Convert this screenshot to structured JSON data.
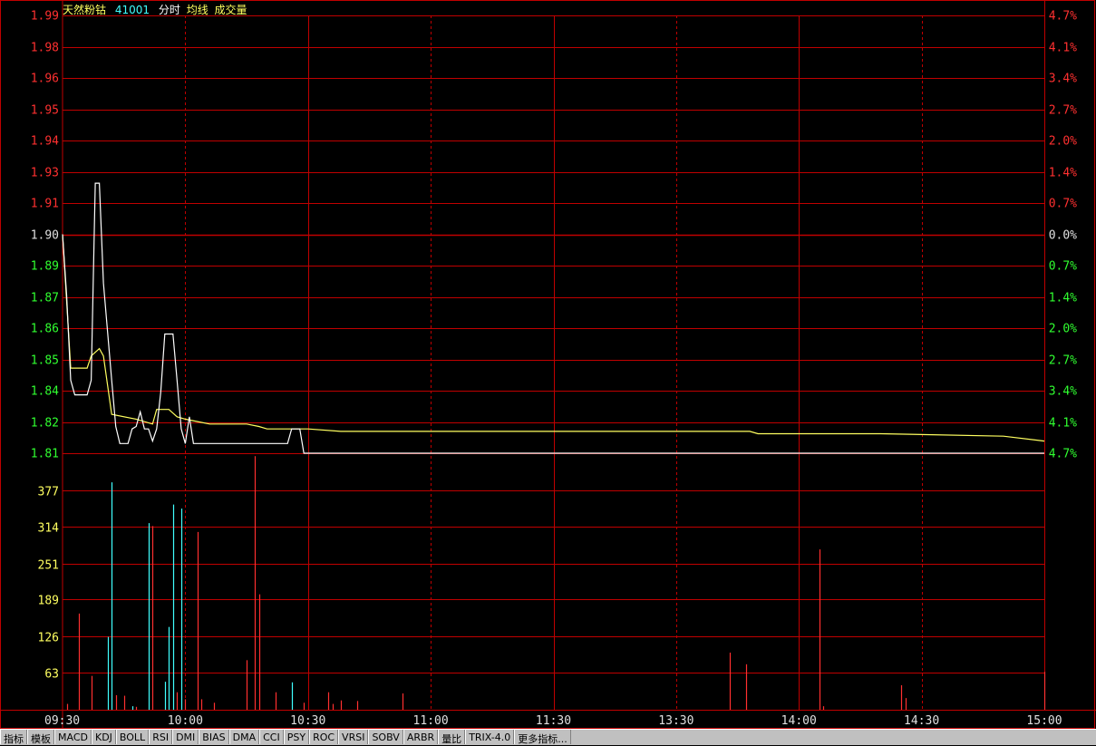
{
  "header": {
    "name": "天然粉钴",
    "code": "41001",
    "mode": "分时",
    "avg_label": "均线",
    "vol_label": "成交量"
  },
  "colors": {
    "grid": "#c00000",
    "price_up": "#ff3030",
    "price_down": "#30ff30",
    "price_flat": "#e0e0e0",
    "price_line": "#ffffff",
    "avg_line": "#ffff60",
    "vol_up": "#ff3030",
    "vol_down": "#40ffff",
    "time_label": "#e0e0e0",
    "vol_label": "#ffff60",
    "title": "#ffff60",
    "code": "#40ffff"
  },
  "chart_data": {
    "type": "line",
    "x_ticks": [
      "09:30",
      "10:00",
      "10:30",
      "11:00",
      "11:30",
      "13:30",
      "14:00",
      "14:30",
      "15:00"
    ],
    "price_axis": {
      "prev_close": 1.9,
      "left_labels": [
        "1.99",
        "1.98",
        "1.96",
        "1.95",
        "1.94",
        "1.93",
        "1.91",
        "1.90",
        "1.89",
        "1.87",
        "1.86",
        "1.85",
        "1.84",
        "1.82",
        "1.81"
      ],
      "right_labels": [
        "4.7%",
        "4.1%",
        "3.4%",
        "2.7%",
        "2.0%",
        "1.4%",
        "0.7%",
        "0.0%",
        "0.7%",
        "1.4%",
        "2.0%",
        "2.7%",
        "3.4%",
        "4.1%",
        "4.7%"
      ],
      "ylim": [
        1.81,
        1.99
      ]
    },
    "volume_axis": {
      "labels": [
        "377",
        "314",
        "251",
        "189",
        "126",
        "63"
      ],
      "ylim": [
        0,
        440
      ]
    },
    "price_series": {
      "name": "分时",
      "points": [
        [
          0,
          1.9
        ],
        [
          1,
          1.875
        ],
        [
          2,
          1.84
        ],
        [
          3,
          1.834
        ],
        [
          5,
          1.834
        ],
        [
          6,
          1.834
        ],
        [
          7,
          1.84
        ],
        [
          8,
          1.921
        ],
        [
          9,
          1.921
        ],
        [
          10,
          1.88
        ],
        [
          12,
          1.84
        ],
        [
          13,
          1.821
        ],
        [
          14,
          1.814
        ],
        [
          15,
          1.814
        ],
        [
          16,
          1.814
        ],
        [
          17,
          1.82
        ],
        [
          18,
          1.821
        ],
        [
          19,
          1.827
        ],
        [
          20,
          1.82
        ],
        [
          21,
          1.82
        ],
        [
          22,
          1.815
        ],
        [
          23,
          1.82
        ],
        [
          24,
          1.835
        ],
        [
          25,
          1.859
        ],
        [
          27,
          1.859
        ],
        [
          28,
          1.84
        ],
        [
          29,
          1.82
        ],
        [
          30,
          1.814
        ],
        [
          31,
          1.825
        ],
        [
          32,
          1.814
        ],
        [
          33,
          1.814
        ],
        [
          34,
          1.814
        ],
        [
          35,
          1.814
        ],
        [
          36,
          1.814
        ],
        [
          37,
          1.814
        ],
        [
          38,
          1.814
        ],
        [
          40,
          1.814
        ],
        [
          50,
          1.814
        ],
        [
          55,
          1.814
        ],
        [
          56,
          1.82
        ],
        [
          58,
          1.82
        ],
        [
          59,
          1.81
        ],
        [
          60,
          1.81
        ],
        [
          100,
          1.81
        ],
        [
          150,
          1.81
        ],
        [
          200,
          1.81
        ],
        [
          240,
          1.81
        ]
      ]
    },
    "avg_series": {
      "name": "均线",
      "points": [
        [
          0,
          1.9
        ],
        [
          2,
          1.845
        ],
        [
          6,
          1.845
        ],
        [
          7,
          1.85
        ],
        [
          9,
          1.853
        ],
        [
          10,
          1.85
        ],
        [
          12,
          1.826
        ],
        [
          18,
          1.824
        ],
        [
          22,
          1.822
        ],
        [
          23,
          1.828
        ],
        [
          26,
          1.828
        ],
        [
          28,
          1.825
        ],
        [
          30,
          1.824
        ],
        [
          33,
          1.823
        ],
        [
          36,
          1.822
        ],
        [
          40,
          1.822
        ],
        [
          45,
          1.822
        ],
        [
          48,
          1.821
        ],
        [
          50,
          1.82
        ],
        [
          60,
          1.82
        ],
        [
          68,
          1.819
        ],
        [
          100,
          1.819
        ],
        [
          140,
          1.819
        ],
        [
          168,
          1.819
        ],
        [
          170,
          1.818
        ],
        [
          200,
          1.818
        ],
        [
          230,
          1.817
        ],
        [
          240,
          1.815
        ]
      ]
    },
    "volume_bars": [
      {
        "m": 1,
        "v": 10,
        "dir": "up"
      },
      {
        "m": 4,
        "v": 165,
        "dir": "up"
      },
      {
        "m": 7,
        "v": 58,
        "dir": "up"
      },
      {
        "m": 11,
        "v": 125,
        "dir": "down"
      },
      {
        "m": 12,
        "v": 390,
        "dir": "down"
      },
      {
        "m": 13,
        "v": 25,
        "dir": "up"
      },
      {
        "m": 15,
        "v": 24,
        "dir": "up"
      },
      {
        "m": 17,
        "v": 6,
        "dir": "down"
      },
      {
        "m": 18,
        "v": 5,
        "dir": "up"
      },
      {
        "m": 21,
        "v": 320,
        "dir": "down"
      },
      {
        "m": 22,
        "v": 315,
        "dir": "up"
      },
      {
        "m": 25,
        "v": 48,
        "dir": "down"
      },
      {
        "m": 26,
        "v": 142,
        "dir": "down"
      },
      {
        "m": 27,
        "v": 352,
        "dir": "down"
      },
      {
        "m": 28,
        "v": 30,
        "dir": "up"
      },
      {
        "m": 29,
        "v": 345,
        "dir": "down"
      },
      {
        "m": 30,
        "v": 18,
        "dir": "up"
      },
      {
        "m": 33,
        "v": 305,
        "dir": "up"
      },
      {
        "m": 34,
        "v": 18,
        "dir": "up"
      },
      {
        "m": 37,
        "v": 12,
        "dir": "up"
      },
      {
        "m": 45,
        "v": 85,
        "dir": "up"
      },
      {
        "m": 47,
        "v": 435,
        "dir": "up"
      },
      {
        "m": 48,
        "v": 198,
        "dir": "up"
      },
      {
        "m": 52,
        "v": 30,
        "dir": "up"
      },
      {
        "m": 56,
        "v": 47,
        "dir": "down"
      },
      {
        "m": 59,
        "v": 12,
        "dir": "up"
      },
      {
        "m": 65,
        "v": 30,
        "dir": "up"
      },
      {
        "m": 66,
        "v": 10,
        "dir": "up"
      },
      {
        "m": 68,
        "v": 16,
        "dir": "up"
      },
      {
        "m": 72,
        "v": 15,
        "dir": "up"
      },
      {
        "m": 83,
        "v": 28,
        "dir": "up"
      },
      {
        "m": 163,
        "v": 98,
        "dir": "up"
      },
      {
        "m": 167,
        "v": 78,
        "dir": "up"
      },
      {
        "m": 185,
        "v": 275,
        "dir": "up"
      },
      {
        "m": 186,
        "v": 6,
        "dir": "up"
      },
      {
        "m": 205,
        "v": 42,
        "dir": "up"
      },
      {
        "m": 206,
        "v": 20,
        "dir": "up"
      },
      {
        "m": 240,
        "v": 65,
        "dir": "up"
      }
    ]
  },
  "indicator_tabs": [
    "指标",
    "模板",
    "MACD",
    "KDJ",
    "BOLL",
    "RSI",
    "DMI",
    "BIAS",
    "DMA",
    "CCI",
    "PSY",
    "ROC",
    "VRSI",
    "SOBV",
    "ARBR",
    "量比",
    "TRIX-4.0",
    "更多指标..."
  ]
}
